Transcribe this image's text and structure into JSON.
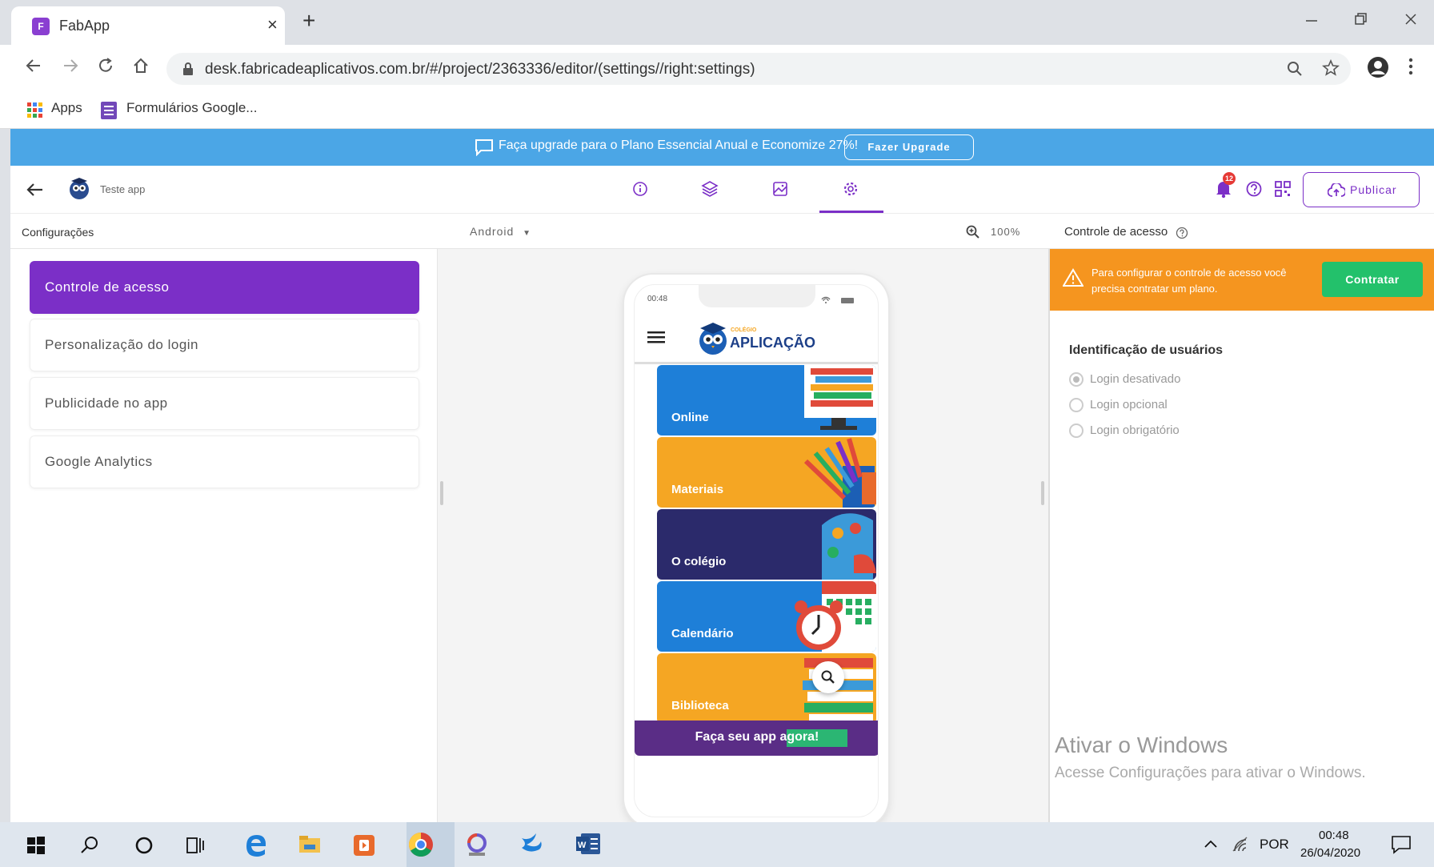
{
  "browser": {
    "tab_title": "FabApp",
    "tab_favicon": "F",
    "tab_close": "×",
    "new_tab": "+",
    "url": "desk.fabricadeaplicativos.com.br/#/project/2363336/editor/(settings//right:settings)",
    "bookmarks": [
      "Apps",
      "Formulários Google..."
    ]
  },
  "banner": {
    "text": "Faça upgrade para o Plano Essencial Anual e Economize 27%!",
    "button": "Fazer Upgrade"
  },
  "toolbar": {
    "app_name": "Teste app",
    "notification_count": "12",
    "publish": "Publicar"
  },
  "subhead": {
    "left_title": "Configurações",
    "platform": "Android",
    "zoom": "100%",
    "right_title": "Controle de acesso"
  },
  "menu": [
    "Controle de acesso",
    "Personalização do login",
    "Publicidade no app",
    "Google Analytics"
  ],
  "phone": {
    "time": "00:48",
    "logo_small": "COLÉGIO",
    "logo": "APLICAÇÃO",
    "cards": [
      {
        "label": "Online",
        "color": "#1e7fd8"
      },
      {
        "label": "Materiais",
        "color": "#f5a623"
      },
      {
        "label": "O colégio",
        "color": "#2b2a6b"
      },
      {
        "label": "Calendário",
        "color": "#1e7fd8"
      },
      {
        "label": "Biblioteca",
        "color": "#f5a623"
      }
    ],
    "footer": "Faça seu app agora!"
  },
  "access": {
    "warning": "Para configurar o controle de acesso você precisa contratar um plano.",
    "contract": "Contratar",
    "section_title": "Identificação de usuários",
    "options": [
      "Login desativado",
      "Login opcional",
      "Login obrigatório"
    ]
  },
  "watermark": {
    "title": "Ativar o Windows",
    "subtitle": "Acesse Configurações para ativar o Windows."
  },
  "taskbar": {
    "lang": "POR",
    "time": "00:48",
    "date": "26/04/2020"
  },
  "colors": {
    "accent": "#7b2fc7",
    "banner": "#4ba6e6",
    "warning": "#f5951f",
    "contract": "#23c16b"
  }
}
